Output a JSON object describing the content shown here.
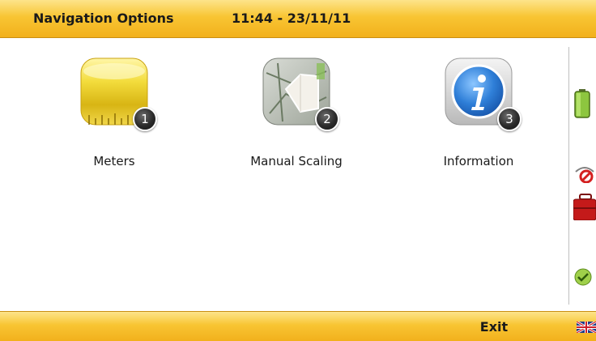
{
  "header": {
    "title": "Navigation Options",
    "clock": "11:44 - 23/11/11"
  },
  "menu": {
    "items": [
      {
        "label": "Meters",
        "badge": "1",
        "icon": "ruler-icon"
      },
      {
        "label": "Manual Scaling",
        "badge": "2",
        "icon": "map-icon"
      },
      {
        "label": "Information",
        "badge": "3",
        "icon": "info-icon"
      }
    ]
  },
  "footer": {
    "exit_label": "Exit"
  },
  "status": {
    "battery": "battery-full-icon",
    "gps": "gps-off-icon",
    "briefcase": "briefcase-icon",
    "ok": "check-icon"
  },
  "colors": {
    "bar": "#f8c533",
    "badge": "#2b2b2b"
  }
}
